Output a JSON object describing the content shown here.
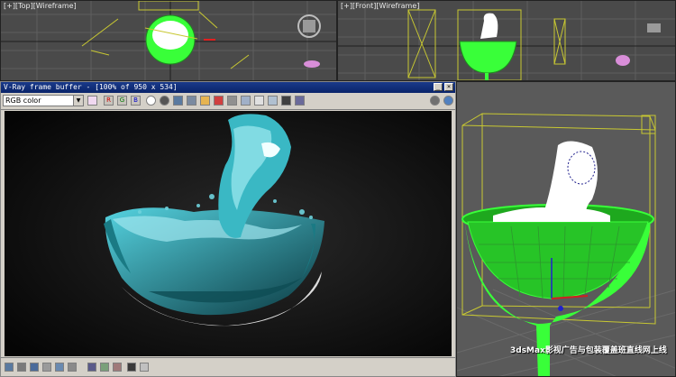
{
  "viewports": {
    "top": {
      "label": "[+][Top][Wireframe]"
    },
    "front": {
      "label": "[+][Front][Wireframe]"
    }
  },
  "vfb": {
    "title": "V-Ray frame buffer - [100% of 950 x 534]",
    "channel": "RGB color",
    "buttons": {
      "red": "R",
      "green": "G",
      "blue": "B"
    }
  },
  "watermark": "3dsMax影视广告与包装覆盖班直线网上线",
  "colors": {
    "wire_green": "#39ff39",
    "wire_yellow": "#c8c832",
    "water_cyan": "#2fb5c4"
  }
}
